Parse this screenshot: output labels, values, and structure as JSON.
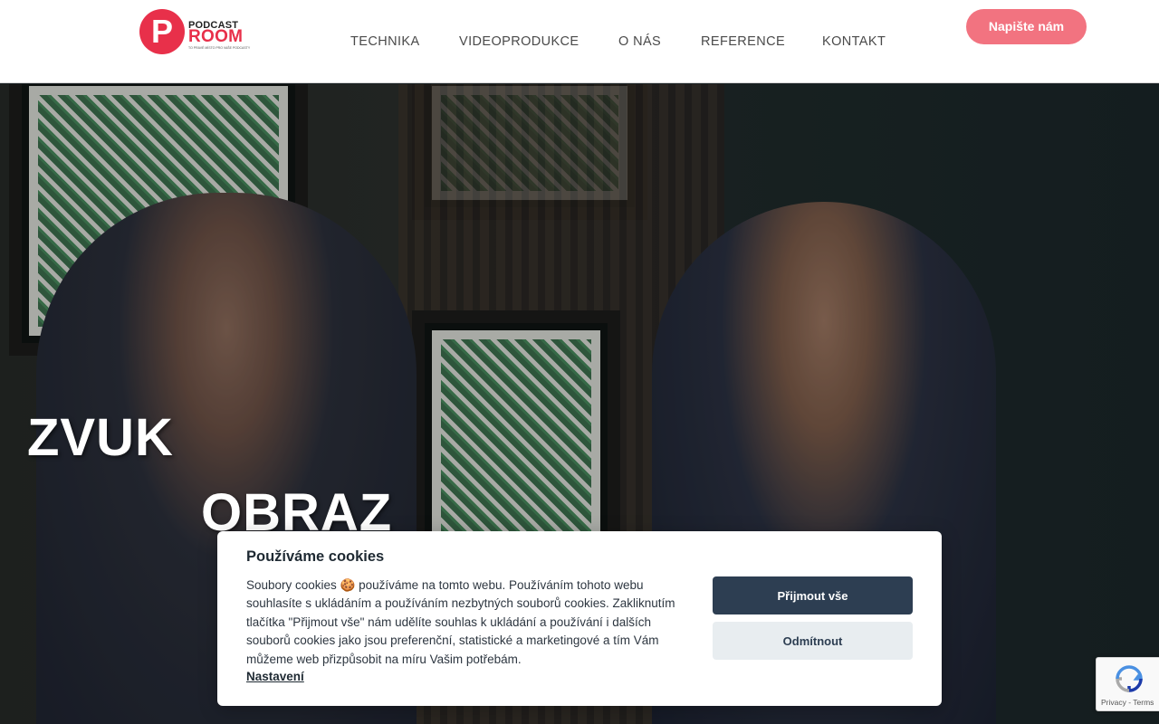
{
  "header": {
    "logo": {
      "letter": "P",
      "line1": "PODCAST",
      "line2": "ROOM",
      "tagline": "TO PRAVÉ MÍSTO PRO VAŠE PODCASTY"
    },
    "nav": [
      {
        "label": "TECHNIKA"
      },
      {
        "label": "VIDEOPRODUKCE"
      },
      {
        "label": "O NÁS"
      },
      {
        "label": "REFERENCE"
      },
      {
        "label": "KONTAKT"
      }
    ],
    "cta_label": "Napište nám"
  },
  "hero": {
    "word1": "ZVUK",
    "word2": "OBRAZ"
  },
  "cookie": {
    "title": "Používáme cookies",
    "text": "Soubory cookies 🍪 používáme na tomto webu. Používáním tohoto webu souhlasíte s ukládáním a používáním nezbytných souborů cookies. Zakliknutím tlačítka \"Přijmout vše\" nám udělíte souhlas k ukládání a používání i dalších souborů cookies jako jsou preferenční, statistické a marketingové a tím Vám můžeme web přizpůsobit na míru Vašim potřebám.",
    "settings_link": "Nastavení",
    "accept_label": "Přijmout vše",
    "decline_label": "Odmítnout"
  },
  "recaptcha": {
    "text": "Privacy - Terms"
  },
  "colors": {
    "brand_red": "#e8304a",
    "cta_pink": "#f27380",
    "dark_button": "#2d3e52"
  }
}
